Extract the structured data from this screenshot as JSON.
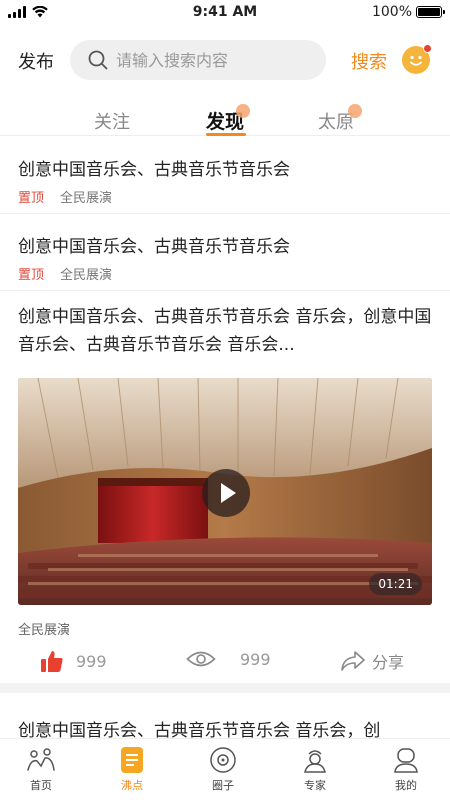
{
  "status_bar": {
    "time": "9:41 AM",
    "battery": "100%"
  },
  "top_bar": {
    "publish": "发布",
    "search_placeholder": "请输入搜索内容",
    "search_button": "搜索"
  },
  "tabs": [
    {
      "label": "关注"
    },
    {
      "label": "发现"
    },
    {
      "label": "太原"
    }
  ],
  "feed": {
    "items": [
      {
        "title": "创意中国音乐会、古典音乐节音乐会",
        "pin": "置顶",
        "tag": "全民展演"
      },
      {
        "title": "创意中国音乐会、古典音乐节音乐会",
        "pin": "置顶",
        "tag": "全民展演"
      }
    ],
    "video_post": {
      "title": "创意中国音乐会、古典音乐节音乐会 音乐会，创意中国音乐会、古典音乐节音乐会 音乐会...",
      "duration": "01:21",
      "tag": "全民展演",
      "likes": "999",
      "views": "999",
      "share": "分享"
    },
    "partial_title": "创意中国音乐会、古典音乐节音乐会 音乐会，创"
  },
  "bottom_nav": [
    {
      "label": "首页",
      "icon": "home-people-icon"
    },
    {
      "label": "沸点",
      "icon": "document-list-icon"
    },
    {
      "label": "圈子",
      "icon": "disc-icon"
    },
    {
      "label": "专家",
      "icon": "expert-icon"
    },
    {
      "label": "我的",
      "icon": "profile-icon"
    }
  ],
  "colors": {
    "accent": "#f08a1c",
    "pin": "#e04a3c",
    "like": "#e8412f"
  }
}
